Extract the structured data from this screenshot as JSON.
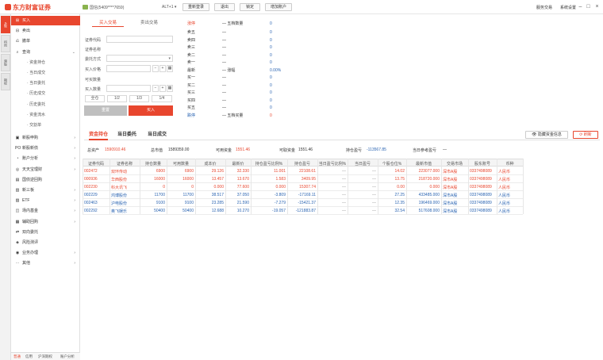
{
  "titlebar": {
    "logo": "东方财富证券",
    "account": "国信(5409****7659)",
    "hotkey": "ALT+1 ▾",
    "relogin": "重新登录",
    "exit": "退出",
    "lock": "锁定",
    "add_account": "增加账户",
    "link_service": "服务交易",
    "link_settings": "系统设置"
  },
  "vtabs": [
    "A股",
    "科创",
    "港股",
    "期权"
  ],
  "sidebar": {
    "items": [
      {
        "label": "买入",
        "icon": "buy-icon",
        "active": true
      },
      {
        "label": "卖出",
        "icon": "sell-icon"
      },
      {
        "label": "撤单",
        "icon": "cancel-order-icon"
      },
      {
        "label": "查询",
        "icon": "search-icon",
        "expand": true
      },
      {
        "label": "资金持仓",
        "sub": true
      },
      {
        "label": "当日成交",
        "sub": true
      },
      {
        "label": "当日委托",
        "sub": true
      },
      {
        "label": "历史成交",
        "sub": true
      },
      {
        "label": "历史委托",
        "sub": true
      },
      {
        "label": "资金流水",
        "sub": true
      },
      {
        "label": "交割单",
        "sub": true
      },
      {
        "label": "新股申购",
        "icon": "ipo-icon",
        "arrow": true
      },
      {
        "label": "新股新债",
        "icon": "po-icon",
        "arrow": true
      },
      {
        "label": "账户分析",
        "icon": "chart-icon",
        "arrow": true
      },
      {
        "label": "天天宝理财",
        "icon": "wallet-icon",
        "arrow": true
      },
      {
        "label": "国债逆回购",
        "icon": "bond-icon"
      },
      {
        "label": "新三板",
        "icon": "board-icon",
        "arrow": true
      },
      {
        "label": "ETF",
        "icon": "etf-icon",
        "arrow": true
      },
      {
        "label": "场内基金",
        "icon": "fund-icon",
        "arrow": true
      },
      {
        "label": "辅助回购",
        "icon": "repo-icon",
        "arrow": true
      },
      {
        "label": "双向委托",
        "icon": "dual-order-icon"
      },
      {
        "label": "风险测评",
        "icon": "risk-icon"
      },
      {
        "label": "业务办理",
        "icon": "business-icon",
        "arrow": true
      },
      {
        "label": "其他",
        "icon": "more-icon",
        "arrow": true
      }
    ]
  },
  "bottom_tabs": [
    "普通",
    "信用",
    "沪深期权",
    "账户分析"
  ],
  "order": {
    "tab_buy": "买入交易",
    "tab_sell": "卖出交易",
    "code_label": "证券代码",
    "name_label": "证券名称",
    "method_label": "委托方式",
    "price_label": "买入价格",
    "avail_label": "可买数量",
    "qty_label": "买入数量",
    "q_all": "全仓",
    "q_half": "1/2",
    "q_third": "1/3",
    "q_quarter": "1/4",
    "reset": "重置",
    "submit": "买入"
  },
  "book": {
    "limit_up": "涨停",
    "limit_down": "跌停",
    "dash": "—",
    "high_label": "五档数量",
    "low_label": "五档买量",
    "latest": "最新",
    "change_label": "涨幅",
    "change": "0.00%",
    "levels": [
      {
        "l": "卖五",
        "v": "0"
      },
      {
        "l": "卖四",
        "v": "0"
      },
      {
        "l": "卖三",
        "v": "0"
      },
      {
        "l": "卖二",
        "v": "0"
      },
      {
        "l": "卖一",
        "v": "0"
      },
      {
        "l": "买一",
        "v": "0"
      },
      {
        "l": "买二",
        "v": "0"
      },
      {
        "l": "买三",
        "v": "0"
      },
      {
        "l": "买四",
        "v": "0"
      },
      {
        "l": "买五",
        "v": "0"
      }
    ],
    "zero": "0"
  },
  "positions": {
    "tab_holdings": "资金持仓",
    "tab_orders": "当日委托",
    "tab_trades": "当日成交",
    "btn_info": "隐藏资金信息",
    "btn_refresh": "刷新",
    "summary": {
      "total_assets_label": "总资产",
      "total_assets": "1590910.46",
      "market_value_label": "总市值",
      "market_value": "1589359.00",
      "available_label": "可用资金",
      "available": "1551.46",
      "withdrawable_label": "可取资金",
      "withdrawable": "1551.46",
      "pnl_label": "持仓盈亏",
      "pnl": "-113567.85",
      "today_pnl_label": "当日参考盈亏",
      "today_pnl": "—"
    },
    "headers": [
      "证券代码",
      "证券名称",
      "持仓数量",
      "可用数量",
      "成本价",
      "最新价",
      "持仓盈亏比例%",
      "持仓盈亏",
      "当日盈亏比例%",
      "当日盈亏",
      "个股仓位%",
      "最新市值",
      "交易市场",
      "股东账号",
      "币种"
    ],
    "rows": [
      [
        "002472",
        "双环传动",
        "6900",
        "6900",
        "29.126",
        "32.330",
        "11.001",
        "22108.61",
        "—",
        "—",
        "14.02",
        "223077.000",
        "深市A股",
        "0337498089",
        "人民币"
      ],
      [
        "000936",
        "华西股份",
        "16000",
        "16000",
        "13.457",
        "13.670",
        "1.583",
        "3409.95",
        "—",
        "—",
        "13.75",
        "218720.000",
        "深市A股",
        "0337498089",
        "人民币"
      ],
      [
        "002230",
        "科大讯飞",
        "0",
        "0",
        "0.000",
        "77.600",
        "0.000",
        "15307.74",
        "—",
        "—",
        "0.00",
        "0.000",
        "深市A股",
        "0337498089",
        "人民币"
      ],
      [
        "002229",
        "鸿博股份",
        "11700",
        "11700",
        "38.517",
        "37.050",
        "-3.809",
        "-17169.11",
        "—",
        "—",
        "27.25",
        "433485.000",
        "深市A股",
        "0337498089",
        "人民币"
      ],
      [
        "002463",
        "沪电股份",
        "9100",
        "9100",
        "23.285",
        "21.590",
        "-7.279",
        "-15421.37",
        "—",
        "—",
        "12.35",
        "196469.000",
        "深市A股",
        "0337498089",
        "人民币"
      ],
      [
        "002292",
        "奥飞娱乐",
        "50400",
        "50400",
        "12.688",
        "10.270",
        "-19.057",
        "-121883.87",
        "—",
        "—",
        "32.54",
        "517608.000",
        "深市A股",
        "0337498089",
        "人民币"
      ]
    ]
  }
}
